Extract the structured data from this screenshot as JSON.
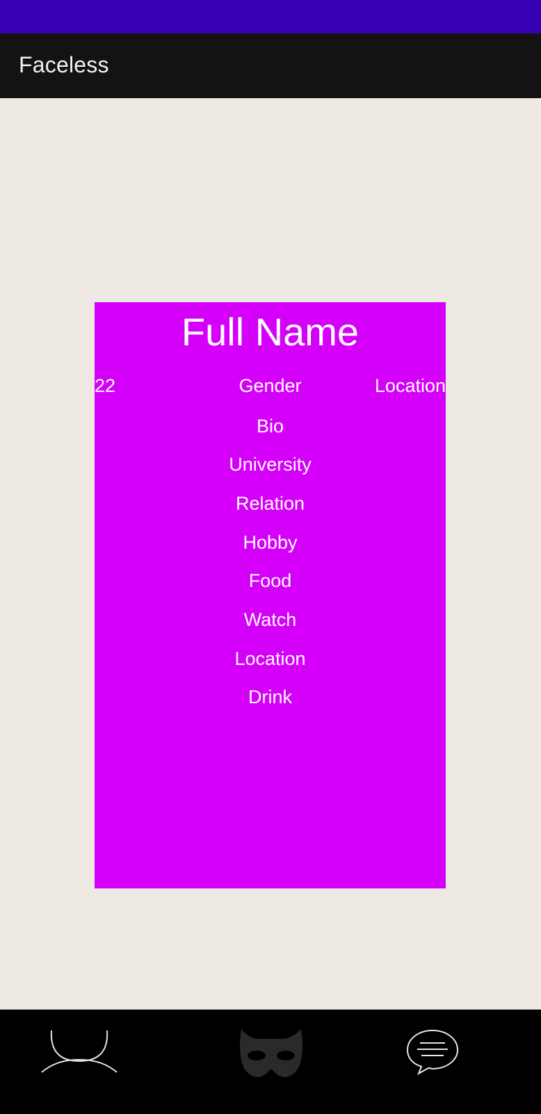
{
  "app": {
    "title": "Faceless"
  },
  "profile": {
    "full_name": "Full Name",
    "age": "22",
    "gender": "Gender",
    "location_top": "Location",
    "fields": [
      "Bio",
      "University",
      "Relation",
      "Hobby",
      "Food",
      "Watch",
      "Location",
      "Drink"
    ]
  },
  "nav": {
    "items": [
      {
        "icon": "face-icon"
      },
      {
        "icon": "mask-icon"
      },
      {
        "icon": "chat-bubble-icon"
      }
    ]
  },
  "colors": {
    "status_bar": "#3700B3",
    "app_bar": "#131313",
    "background": "#EEE9E3",
    "card": "#D500F9",
    "nav_bar": "#000000"
  }
}
